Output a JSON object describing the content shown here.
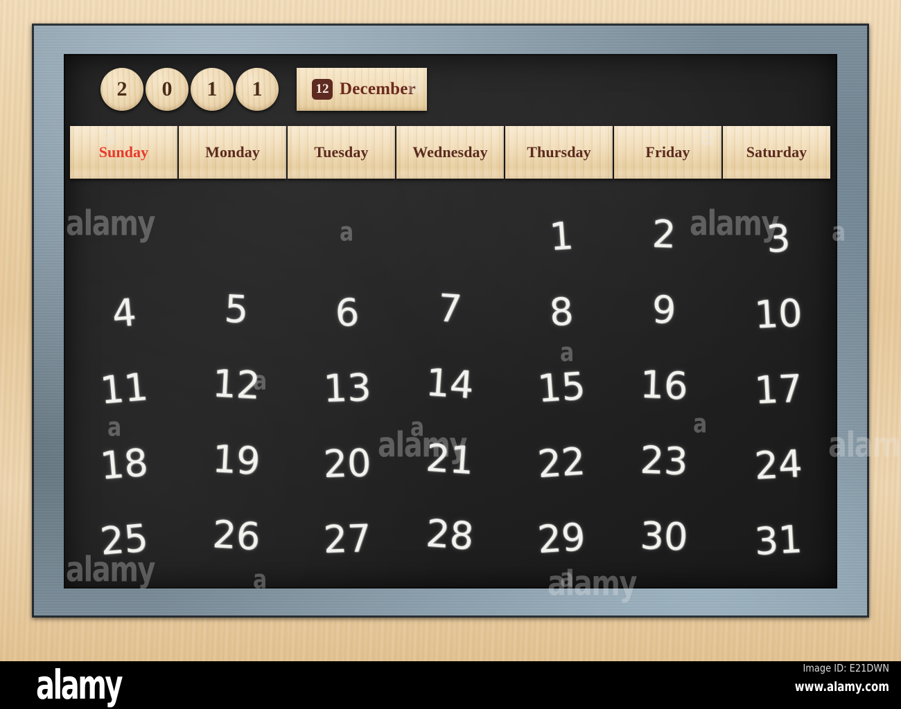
{
  "calendar": {
    "year_digits": [
      "2",
      "0",
      "1",
      "1"
    ],
    "year": "2011",
    "month_number": "12",
    "month_name": "December",
    "weekdays": [
      {
        "label": "Sunday",
        "color": "#e8392c",
        "highlight": true
      },
      {
        "label": "Monday",
        "color": "#5b2b1e",
        "highlight": false
      },
      {
        "label": "Tuesday",
        "color": "#5b2b1e",
        "highlight": false
      },
      {
        "label": "Wednesday",
        "color": "#5b2b1e",
        "highlight": false
      },
      {
        "label": "Thursday",
        "color": "#5b2b1e",
        "highlight": false
      },
      {
        "label": "Friday",
        "color": "#5b2b1e",
        "highlight": false
      },
      {
        "label": "Saturday",
        "color": "#5b2b1e",
        "highlight": false
      }
    ],
    "leading_blanks": 4,
    "days": [
      "1",
      "2",
      "3",
      "4",
      "5",
      "6",
      "7",
      "8",
      "9",
      "10",
      "11",
      "12",
      "13",
      "14",
      "15",
      "16",
      "17",
      "18",
      "19",
      "20",
      "21",
      "22",
      "23",
      "24",
      "25",
      "26",
      "27",
      "28",
      "29",
      "30",
      "31"
    ],
    "grid_rows": [
      [
        "",
        "",
        "",
        "",
        "1",
        "2",
        "3"
      ],
      [
        "4",
        "5",
        "6",
        "7",
        "8",
        "9",
        "10"
      ],
      [
        "11",
        "12",
        "13",
        "14",
        "15",
        "16",
        "17"
      ],
      [
        "18",
        "19",
        "20",
        "21",
        "22",
        "23",
        "24"
      ],
      [
        "25",
        "26",
        "27",
        "28",
        "29",
        "30",
        "31"
      ]
    ]
  },
  "watermark": {
    "text": "alamy",
    "small_text": "a"
  },
  "banner": {
    "logo": "alamy",
    "image_id": "Image ID: E21DWN",
    "url": "www.alamy.com"
  },
  "colors": {
    "chalkboard": "#222222",
    "slate_edge": "#6d7f8d",
    "wood": "#eed6ae",
    "chalk": "#f2f2ee",
    "sunday_red": "#e8392c",
    "stamp_brown": "#5b2b1e"
  }
}
